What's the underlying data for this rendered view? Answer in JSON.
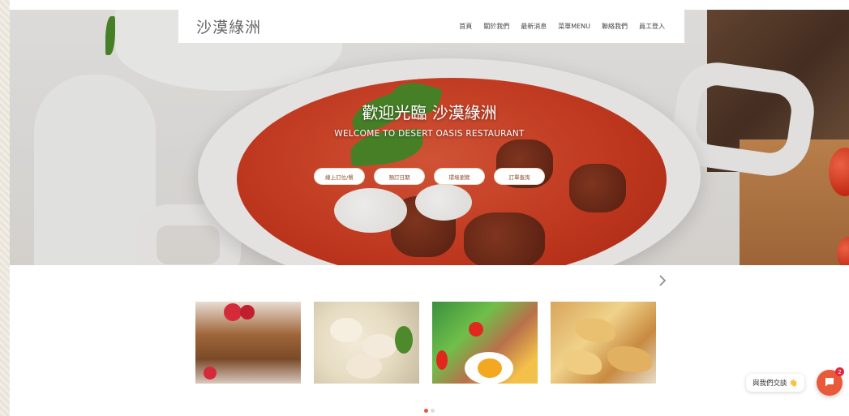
{
  "brand": {
    "name": "沙漠綠洲"
  },
  "nav": {
    "items": [
      {
        "label": "首頁"
      },
      {
        "label": "關於我們"
      },
      {
        "label": "最新消息"
      },
      {
        "label": "菜單MENU"
      },
      {
        "label": "聯絡我們"
      },
      {
        "label": "員工登入"
      }
    ]
  },
  "hero": {
    "title": "歡迎光臨 沙漠綠洲",
    "subtitle": "WELCOME TO DESERT OASIS RESTAURANT",
    "buttons": [
      {
        "label": "線上訂位/餐"
      },
      {
        "label": "預訂日期"
      },
      {
        "label": "環境瀏覽"
      },
      {
        "label": "訂單查詢"
      }
    ]
  },
  "carousel": {
    "next_icon": "chevron-right-icon",
    "cards": [
      {
        "subject": "berry-oat-bars"
      },
      {
        "subject": "dumplings"
      },
      {
        "subject": "egg-and-salad"
      },
      {
        "subject": "crepes"
      }
    ],
    "dots": {
      "total": 2,
      "active": 0
    }
  },
  "chat": {
    "label": "與我們交談 👋",
    "badge": "2",
    "icon": "chat-bubble-icon",
    "color": "#e95a3a"
  }
}
